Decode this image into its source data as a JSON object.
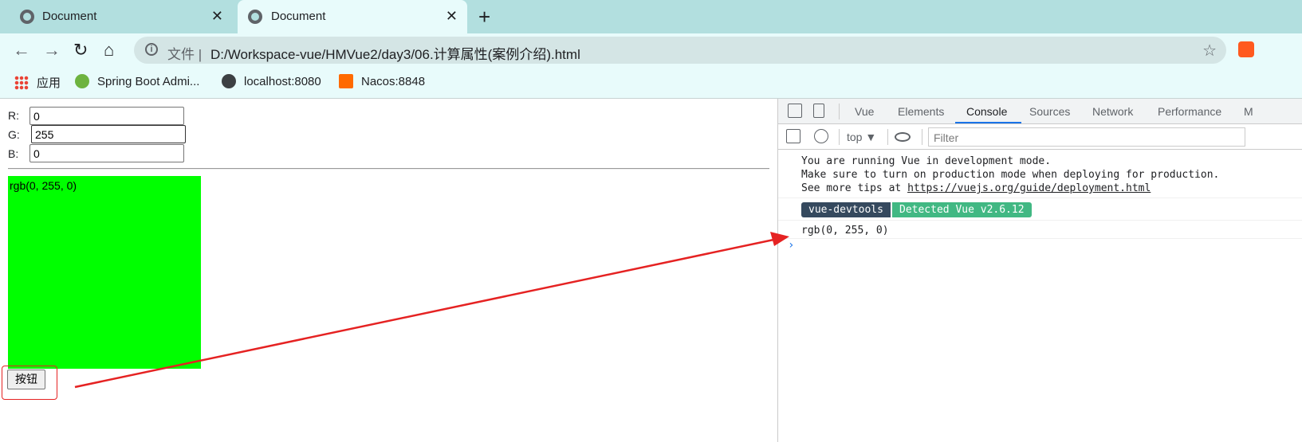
{
  "browser": {
    "tabs": [
      {
        "title": "Document",
        "close": "✕"
      },
      {
        "title": "Document",
        "close": "✕"
      }
    ],
    "new_tab": "+",
    "nav": {
      "back": "←",
      "forward": "→",
      "reload": "↻",
      "home": "⌂"
    },
    "address": {
      "info": "i",
      "label": "文件",
      "url": "D:/Workspace-vue/HMVue2/day3/06.计算属性(案例介绍).html",
      "star": "☆"
    },
    "bookmarks": [
      {
        "label": "应用",
        "icon": "apps-grid-icon"
      },
      {
        "label": "Spring Boot Admi...",
        "icon": "pulse-icon"
      },
      {
        "label": "localhost:8080",
        "icon": "globe-icon"
      },
      {
        "label": "Nacos:8848",
        "icon": "aliyun-icon"
      }
    ]
  },
  "page": {
    "r_label": "R:",
    "r_value": "0",
    "g_label": "G:",
    "g_value": "255",
    "b_label": "B:",
    "b_value": "0",
    "box_text": "rgb(0, 255, 0)",
    "box_color": "#00ff00",
    "button_label": "按钮"
  },
  "devtools": {
    "tabs": [
      "Vue",
      "Elements",
      "Console",
      "Sources",
      "Network",
      "Performance",
      "M"
    ],
    "active_tab": "Console",
    "context": "top ▼",
    "filter_placeholder": "Filter",
    "messages": {
      "line1": "You are running Vue in development mode.",
      "line2": "Make sure to turn on production mode when deploying for production.",
      "line3_prefix": "See more tips at ",
      "line3_link": "https://vuejs.org/guide/deployment.html",
      "badge_left": "vue-devtools",
      "badge_right": "Detected Vue v2.6.12",
      "log": "rgb(0, 255, 0)",
      "prompt": "›"
    }
  },
  "colors": {
    "annotation": "#e52222",
    "vue_dark": "#35495e",
    "vue_green": "#41b883"
  }
}
